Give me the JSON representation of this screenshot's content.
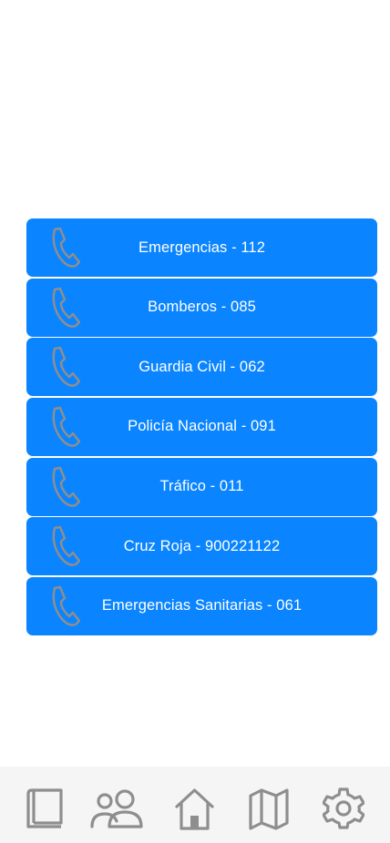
{
  "contacts": [
    {
      "label": "Emergencias - 112"
    },
    {
      "label": "Bomberos - 085"
    },
    {
      "label": "Guardia Civil - 062"
    },
    {
      "label": "Policía Nacional - 091"
    },
    {
      "label": "Tráfico - 011"
    },
    {
      "label": "Cruz Roja - 900221122"
    },
    {
      "label": "Emergencias Sanitarias - 061"
    }
  ],
  "icons": {
    "contact": "phone-icon",
    "tabs": [
      "book-icon",
      "people-icon",
      "home-icon",
      "map-icon",
      "gear-icon"
    ]
  },
  "colors": {
    "accent": "#0a84ff",
    "icon_gray": "#8e8e8e",
    "tab_bar_bg": "#f5f5f5",
    "text_on_accent": "#ffffff"
  }
}
